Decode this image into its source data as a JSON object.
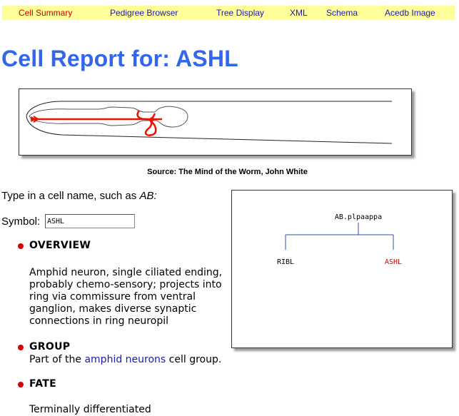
{
  "nav": {
    "items": [
      {
        "label": "Cell Summary",
        "current": true
      },
      {
        "label": "Pedigree Browser",
        "current": false
      },
      {
        "label": "Tree Display",
        "current": false
      },
      {
        "label": "XML",
        "current": false
      },
      {
        "label": "Schema",
        "current": false
      },
      {
        "label": "Acedb Image",
        "current": false
      }
    ]
  },
  "page": {
    "title": "Cell Report for: ASHL",
    "image_caption": "Source: The Mind of the Worm, John White",
    "prompt_prefix": "Type in a cell name, such as ",
    "prompt_example": "AB:",
    "symbol_label": "Symbol:",
    "symbol_value": "ASHL"
  },
  "tree": {
    "root": "AB.plpaappa",
    "left_child": "RIBL",
    "right_child": "ASHL",
    "highlight_color": "#cc0000",
    "line_color": "#2a4fb0"
  },
  "sections": {
    "overview": {
      "heading": "OVERVIEW",
      "lines": [
        "Amphid neuron, single ciliated ending,",
        "probably chemo-sensory; projects into",
        "ring via commissure from ventral",
        "ganglion, makes diverse synaptic",
        "connections in ring neuropil"
      ]
    },
    "group": {
      "heading": "GROUP",
      "prefix": "Part of the ",
      "link": "amphid neurons",
      "suffix": " cell group."
    },
    "fate": {
      "heading": "FATE",
      "text": "Terminally differentiated"
    }
  },
  "colors": {
    "title": "#3366ee",
    "nav_background": "#ffff99",
    "nav_link": "#1a1ab0",
    "nav_current": "#cc0000",
    "bullet": "#dd0000",
    "neuron_trace": "#ee1100"
  }
}
